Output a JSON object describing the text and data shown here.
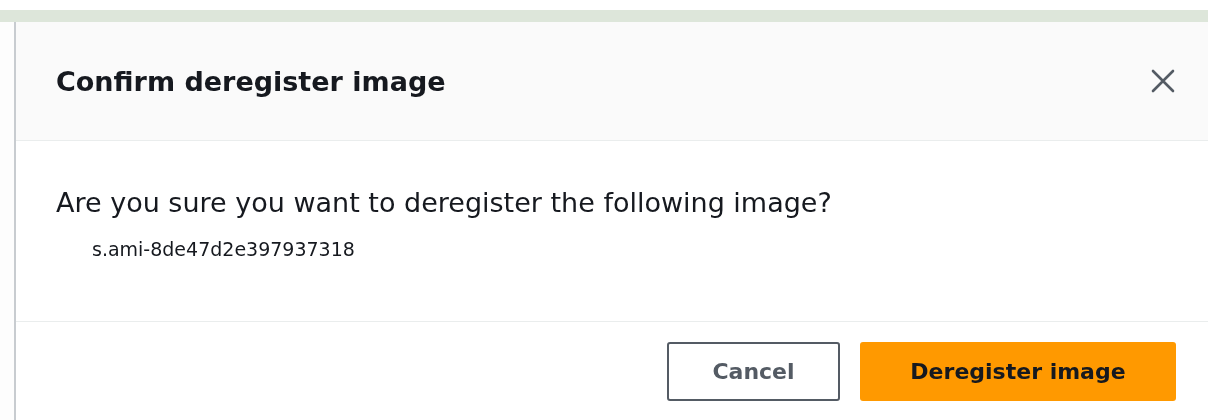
{
  "dialog": {
    "title": "Confirm deregister image",
    "message": "Are you sure you want to deregister the following image?",
    "items": [
      "s.ami-8de47d2e397937318"
    ],
    "buttons": [
      {
        "label": "Cancel",
        "kind": "secondary"
      },
      {
        "label": "Deregister image",
        "kind": "primary"
      }
    ]
  }
}
